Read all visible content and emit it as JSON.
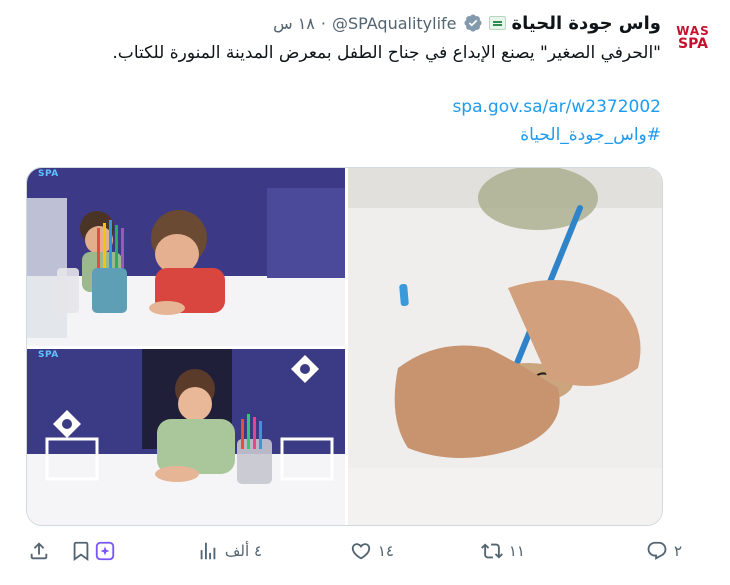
{
  "account": {
    "display_name": "واس جودة الحياة",
    "handle": "@SPAqualitylife",
    "time": "١٨ س",
    "separator": "·",
    "avatar_line1": "WAS",
    "avatar_line2": "SPA"
  },
  "post": {
    "text": "\"الحرفي الصغير\" يصنع الإبداع في جناح الطفل بمعرض المدينة المنورة للكتاب.",
    "link": "spa.gov.sa/ar/w2372002",
    "hashtag": "#واس_جودة_الحياة"
  },
  "media": {
    "watermark": "SPA"
  },
  "actions": {
    "replies": "٢",
    "reposts": "١١",
    "likes": "١٤",
    "views": "٤ ألف"
  },
  "colors": {
    "accent": "#1d9bf0",
    "muted": "#536471",
    "verified": "#829aab",
    "avatar_brand": "#c8102e",
    "grok_icon": "#7856ff"
  },
  "icons": {
    "verified": "verified-badge-icon",
    "reply": "reply-icon",
    "repost": "repost-icon",
    "like": "heart-icon",
    "views": "views-icon",
    "bookmark": "bookmark-icon",
    "grok": "grok-icon",
    "share": "share-icon"
  }
}
